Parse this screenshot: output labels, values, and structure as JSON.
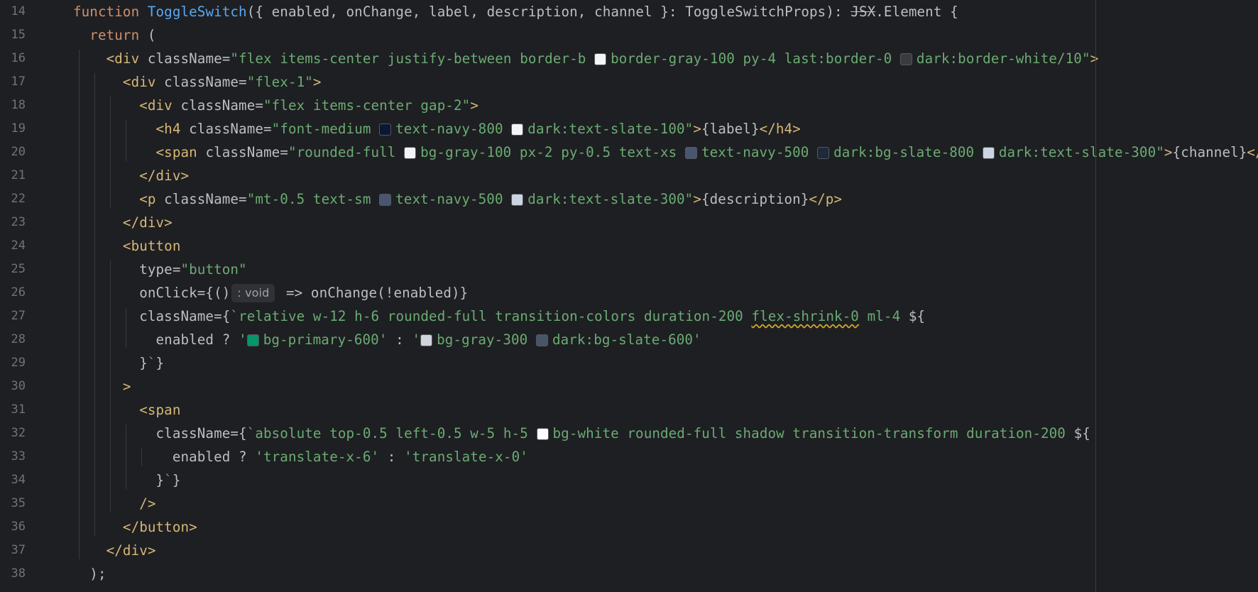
{
  "editor": {
    "line_numbers": [
      "14",
      "15",
      "16",
      "17",
      "18",
      "19",
      "20",
      "21",
      "22",
      "23",
      "24",
      "25",
      "26",
      "27",
      "28",
      "29",
      "30",
      "31",
      "32",
      "33",
      "34",
      "35",
      "36",
      "37",
      "38"
    ],
    "inlay_hint": ": void",
    "lines": [
      [
        [
          "kw",
          "function "
        ],
        [
          "fn",
          "ToggleSwitch"
        ],
        [
          "tx",
          "({ enabled, onChange, label, description, channel }: ToggleSwitchProps): "
        ],
        [
          "strike",
          "JSX"
        ],
        [
          "tx",
          ".Element {"
        ]
      ],
      [
        [
          "kw",
          "  return "
        ],
        [
          "tx",
          "("
        ]
      ],
      [
        [
          "tag",
          "    <div "
        ],
        [
          "attr",
          "className"
        ],
        [
          "tx",
          "="
        ],
        [
          "str",
          "\"flex items-center justify-between border-b "
        ],
        [
          "sw",
          "#f5f5f5"
        ],
        [
          "str",
          "border-gray-100 py-4 last:border-0 "
        ],
        [
          "sw",
          "#3a3b3f"
        ],
        [
          "str",
          "dark:border-white/10\""
        ],
        [
          "tag",
          ">"
        ]
      ],
      [
        [
          "tag",
          "      <div "
        ],
        [
          "attr",
          "className"
        ],
        [
          "tx",
          "="
        ],
        [
          "str",
          "\"flex-1\""
        ],
        [
          "tag",
          ">"
        ]
      ],
      [
        [
          "tag",
          "        <div "
        ],
        [
          "attr",
          "className"
        ],
        [
          "tx",
          "="
        ],
        [
          "str",
          "\"flex items-center gap-2\""
        ],
        [
          "tag",
          ">"
        ]
      ],
      [
        [
          "tag",
          "          <h4 "
        ],
        [
          "attr",
          "className"
        ],
        [
          "tx",
          "="
        ],
        [
          "str",
          "\"font-medium "
        ],
        [
          "sw",
          "#0b1734"
        ],
        [
          "str",
          "text-navy-800 "
        ],
        [
          "sw",
          "#f1f5f9"
        ],
        [
          "str",
          "dark:text-slate-100\""
        ],
        [
          "tag",
          ">"
        ],
        [
          "tx",
          "{label}"
        ],
        [
          "tag",
          "</h4>"
        ]
      ],
      [
        [
          "tag",
          "          <span "
        ],
        [
          "attr",
          "className"
        ],
        [
          "tx",
          "="
        ],
        [
          "str",
          "\"rounded-full "
        ],
        [
          "sw",
          "#f3f4f6"
        ],
        [
          "str",
          "bg-gray-100 px-2 py-0.5 text-xs "
        ],
        [
          "sw",
          "#4a5570"
        ],
        [
          "str",
          "text-navy-500 "
        ],
        [
          "sw",
          "#1e293b"
        ],
        [
          "str",
          "dark:bg-slate-800 "
        ],
        [
          "sw",
          "#cbd5e1"
        ],
        [
          "str",
          "dark:text-slate-300\""
        ],
        [
          "tag",
          ">"
        ],
        [
          "tx",
          "{channel}"
        ],
        [
          "tag",
          "</span>"
        ]
      ],
      [
        [
          "tag",
          "        </div>"
        ]
      ],
      [
        [
          "tag",
          "        <p "
        ],
        [
          "attr",
          "className"
        ],
        [
          "tx",
          "="
        ],
        [
          "str",
          "\"mt-0.5 text-sm "
        ],
        [
          "sw",
          "#4a5570"
        ],
        [
          "str",
          "text-navy-500 "
        ],
        [
          "sw",
          "#cbd5e1"
        ],
        [
          "str",
          "dark:text-slate-300\""
        ],
        [
          "tag",
          ">"
        ],
        [
          "tx",
          "{description}"
        ],
        [
          "tag",
          "</p>"
        ]
      ],
      [
        [
          "tag",
          "      </div>"
        ]
      ],
      [
        [
          "tag",
          "      <button"
        ]
      ],
      [
        [
          "attr",
          "        type"
        ],
        [
          "tx",
          "="
        ],
        [
          "str",
          "\"button\""
        ]
      ],
      [
        [
          "attr",
          "        onClick"
        ],
        [
          "tx",
          "={()"
        ],
        [
          "hint",
          ": void"
        ],
        [
          "tx",
          " => onChange(!enabled)}"
        ]
      ],
      [
        [
          "attr",
          "        className"
        ],
        [
          "tx",
          "={"
        ],
        [
          "str",
          "`relative w-12 h-6 rounded-full transition-colors duration-200 "
        ],
        [
          "warn",
          "flex-shrink-0"
        ],
        [
          "str",
          " ml-4 "
        ],
        [
          "tx",
          "${"
        ]
      ],
      [
        [
          "tx",
          "          enabled ? "
        ],
        [
          "str",
          "'"
        ],
        [
          "sw",
          "#059669"
        ],
        [
          "str",
          "bg-primary-600'"
        ],
        [
          "tx",
          " : "
        ],
        [
          "str",
          "'"
        ],
        [
          "sw",
          "#d1d5db"
        ],
        [
          "str",
          "bg-gray-300 "
        ],
        [
          "sw",
          "#475569"
        ],
        [
          "str",
          "dark:bg-slate-600'"
        ]
      ],
      [
        [
          "tx",
          "        }"
        ],
        [
          "str",
          "`"
        ],
        [
          "tx",
          "}"
        ]
      ],
      [
        [
          "tag",
          "      >"
        ]
      ],
      [
        [
          "tag",
          "        <span"
        ]
      ],
      [
        [
          "attr",
          "          className"
        ],
        [
          "tx",
          "={"
        ],
        [
          "str",
          "`absolute top-0.5 left-0.5 w-5 h-5 "
        ],
        [
          "sw",
          "#ffffff"
        ],
        [
          "str",
          "bg-white rounded-full shadow transition-transform duration-200 "
        ],
        [
          "tx",
          "${"
        ]
      ],
      [
        [
          "tx",
          "            enabled ? "
        ],
        [
          "str",
          "'translate-x-6'"
        ],
        [
          "tx",
          " : "
        ],
        [
          "str",
          "'translate-x-0'"
        ]
      ],
      [
        [
          "tx",
          "          }"
        ],
        [
          "str",
          "`"
        ],
        [
          "tx",
          "}"
        ]
      ],
      [
        [
          "tag",
          "        />"
        ]
      ],
      [
        [
          "tag",
          "      </button>"
        ]
      ],
      [
        [
          "tag",
          "    </div>"
        ]
      ],
      [
        [
          "tx",
          "  );"
        ]
      ]
    ]
  }
}
